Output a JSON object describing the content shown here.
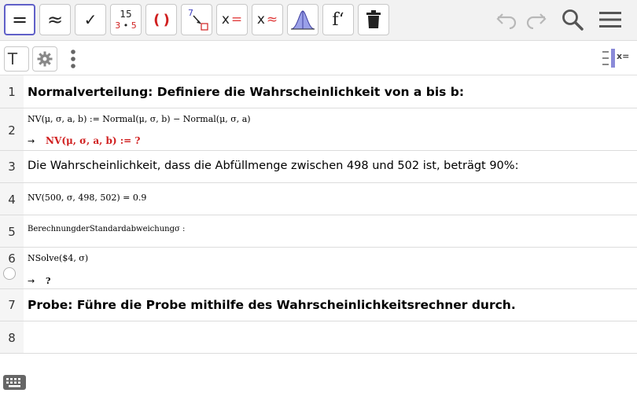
{
  "toolbar": {
    "fraction_icon": {
      "top": "15",
      "left": "3",
      "right": "5"
    },
    "substitute_icon_digit": "7",
    "derivative_label": "f‘",
    "solve_label": "x",
    "numeric_solve_label": "x",
    "equals_glyph": "=",
    "approx_glyph": "≈",
    "check_glyph": "✓",
    "parens_glyph": "( )"
  },
  "subbar": {
    "text_tool_label": "T",
    "algebra_view_label": "x="
  },
  "rows": [
    {
      "num": "1",
      "text": "Normalverteilung: Definiere die Wahrscheinlichkeit von a bis b:"
    },
    {
      "num": "2",
      "input": "NV(μ, σ, a, b) := Normal(μ, σ, b) − Normal(μ, σ, a)",
      "arrow": "→",
      "output": "NV(μ, σ, a, b)  :=  ?"
    },
    {
      "num": "3",
      "text": "Die Wahrscheinlichkeit, dass die Abfüllmenge zwischen 498 und 502 ist, beträgt 90%:"
    },
    {
      "num": "4",
      "input": "NV(500, σ, 498, 502) = 0.9"
    },
    {
      "num": "5",
      "input": "BerechnungderStandardabweichungσ :"
    },
    {
      "num": "6",
      "input": "NSolve($4, σ)",
      "arrow": "→",
      "output": "?"
    },
    {
      "num": "7",
      "text": "Probe: Führe die Probe mithilfe des Wahrscheinlichkeitsrechner durch."
    },
    {
      "num": "8",
      "text": ""
    }
  ],
  "colors": {
    "accent": "#6060c8",
    "error_red": "#d02020",
    "solve_red": "#e03c3c",
    "bell_fill": "#9aa0e8"
  }
}
